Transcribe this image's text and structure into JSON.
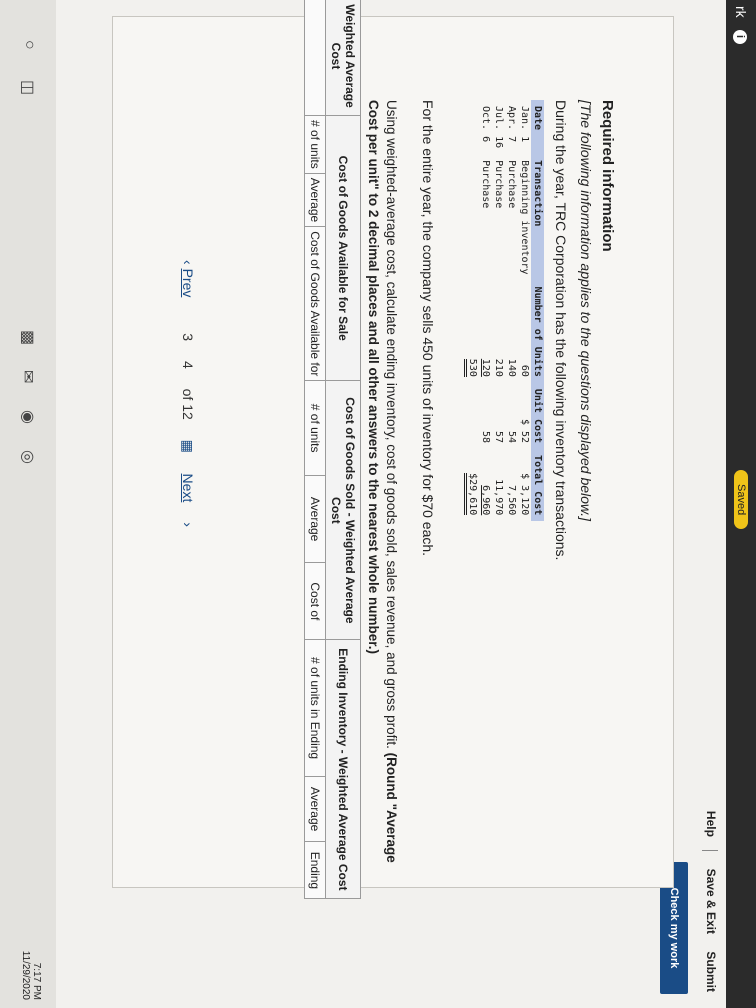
{
  "topbar": {
    "left_text": "rk",
    "info_icon": "i",
    "saved_label": "Saved"
  },
  "header": {
    "help": "Help",
    "save_exit": "Save & Exit",
    "submit": "Submit",
    "check": "Check my work"
  },
  "required": {
    "title": "Required information",
    "note": "[The following information applies to the questions displayed below.]",
    "intro": "During the year, TRC Corporation has the following inventory transactions."
  },
  "inventory_table": {
    "headers": [
      "Date",
      "Transaction",
      "Number of Units",
      "Unit Cost",
      "Total Cost"
    ],
    "rows": [
      [
        "Jan. 1",
        "Beginning inventory",
        "60",
        "$ 52",
        "$ 3,120"
      ],
      [
        "Apr. 7",
        "Purchase",
        "140",
        "54",
        "7,560"
      ],
      [
        "Jul. 16",
        "Purchase",
        "210",
        "57",
        "11,970"
      ],
      [
        "Oct. 6",
        "Purchase",
        "120",
        "58",
        "6,960"
      ]
    ],
    "total_units": "530",
    "total_cost": "$29,610"
  },
  "question": {
    "q1": "For the entire year, the company sells 450 units of inventory for $70 each.",
    "q2_plain": "Using weighted-average cost, calculate ending inventory, cost of goods sold, sales revenue, and gross profit. ",
    "q2_bold": "(Round \"Average Cost per unit\" to 2 decimal places and all other answers to the nearest whole number.)"
  },
  "answer_table": {
    "group_headers": [
      "Weighted Average Cost",
      "Cost of Goods Available for Sale",
      "Cost of Goods Sold - Weighted Average Cost",
      "Ending Inventory - Weighted Average Cost"
    ],
    "sub_headers": [
      "# of units",
      "Average",
      "Cost of Goods Available for",
      "# of units",
      "Average",
      "Cost of",
      "# of units in Ending",
      "Average",
      "Ending"
    ]
  },
  "pager": {
    "prev": "Prev",
    "page_a": "3",
    "page_b": "4",
    "of_label": "of 12",
    "next": "Next"
  },
  "tray": {
    "time": "7:17 PM",
    "date": "11/29/2020"
  }
}
